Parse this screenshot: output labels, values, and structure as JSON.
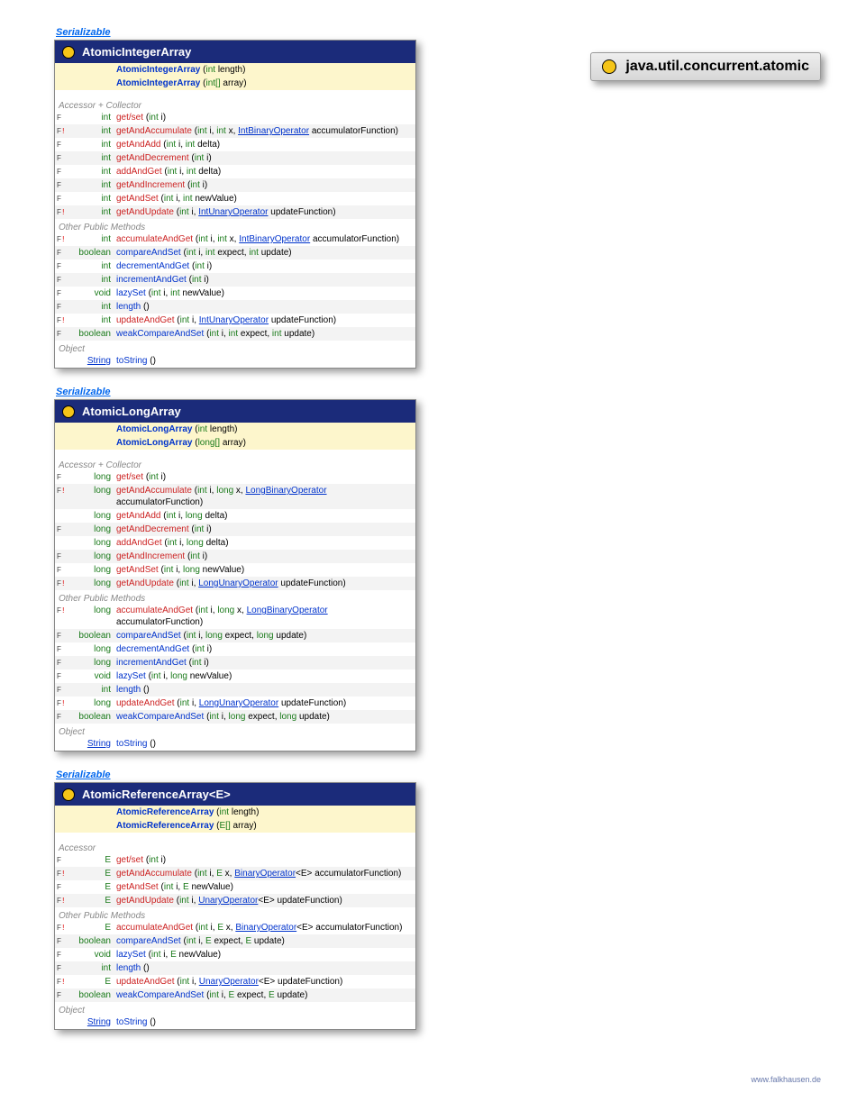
{
  "package": "java.util.concurrent.atomic",
  "serializable_label": "Serializable",
  "footer": "www.falkhausen.de",
  "classes": [
    {
      "name": "AtomicIntegerArray",
      "constructors": [
        {
          "name": "AtomicIntegerArray",
          "params": [
            [
              "int",
              "length"
            ]
          ]
        },
        {
          "name": "AtomicIntegerArray",
          "params": [
            [
              "int[]",
              "array"
            ]
          ]
        }
      ],
      "sections": [
        {
          "title": "Accessor + Collector",
          "methods": [
            {
              "mods": "F",
              "ret": "int",
              "name": "get/set",
              "red": true,
              "params": [
                [
                  "int",
                  "i"
                ]
              ]
            },
            {
              "mods": "F!",
              "ret": "int",
              "name": "getAndAccumulate",
              "red": true,
              "params": [
                [
                  "int",
                  "i"
                ],
                [
                  "int",
                  "x"
                ],
                [
                  "IntBinaryOperator",
                  "accumulatorFunction",
                  "link"
                ]
              ]
            },
            {
              "mods": "F",
              "ret": "int",
              "name": "getAndAdd",
              "red": true,
              "params": [
                [
                  "int",
                  "i"
                ],
                [
                  "int",
                  "delta"
                ]
              ]
            },
            {
              "mods": "F",
              "ret": "int",
              "name": "getAndDecrement",
              "red": true,
              "params": [
                [
                  "int",
                  "i"
                ]
              ]
            },
            {
              "mods": "F",
              "ret": "int",
              "name": "addAndGet",
              "red": true,
              "params": [
                [
                  "int",
                  "i"
                ],
                [
                  "int",
                  "delta"
                ]
              ]
            },
            {
              "mods": "F",
              "ret": "int",
              "name": "getAndIncrement",
              "red": true,
              "params": [
                [
                  "int",
                  "i"
                ]
              ]
            },
            {
              "mods": "F",
              "ret": "int",
              "name": "getAndSet",
              "red": true,
              "params": [
                [
                  "int",
                  "i"
                ],
                [
                  "int",
                  "newValue"
                ]
              ]
            },
            {
              "mods": "F!",
              "ret": "int",
              "name": "getAndUpdate",
              "red": true,
              "params": [
                [
                  "int",
                  "i"
                ],
                [
                  "IntUnaryOperator",
                  "updateFunction",
                  "link"
                ]
              ]
            }
          ]
        },
        {
          "title": "Other Public Methods",
          "methods": [
            {
              "mods": "F!",
              "ret": "int",
              "name": "accumulateAndGet",
              "red": true,
              "params": [
                [
                  "int",
                  "i"
                ],
                [
                  "int",
                  "x"
                ],
                [
                  "IntBinaryOperator",
                  "accumulatorFunction",
                  "link"
                ]
              ]
            },
            {
              "mods": "F",
              "ret": "boolean",
              "name": "compareAndSet",
              "params": [
                [
                  "int",
                  "i"
                ],
                [
                  "int",
                  "expect"
                ],
                [
                  "int",
                  "update"
                ]
              ]
            },
            {
              "mods": "F",
              "ret": "int",
              "name": "decrementAndGet",
              "params": [
                [
                  "int",
                  "i"
                ]
              ]
            },
            {
              "mods": "F",
              "ret": "int",
              "name": "incrementAndGet",
              "params": [
                [
                  "int",
                  "i"
                ]
              ]
            },
            {
              "mods": "F",
              "ret": "void",
              "name": "lazySet",
              "params": [
                [
                  "int",
                  "i"
                ],
                [
                  "int",
                  "newValue"
                ]
              ]
            },
            {
              "mods": "F",
              "ret": "int",
              "name": "length",
              "params": []
            },
            {
              "mods": "F!",
              "ret": "int",
              "name": "updateAndGet",
              "red": true,
              "params": [
                [
                  "int",
                  "i"
                ],
                [
                  "IntUnaryOperator",
                  "updateFunction",
                  "link"
                ]
              ]
            },
            {
              "mods": "F",
              "ret": "boolean",
              "name": "weakCompareAndSet",
              "params": [
                [
                  "int",
                  "i"
                ],
                [
                  "int",
                  "expect"
                ],
                [
                  "int",
                  "update"
                ]
              ]
            }
          ]
        },
        {
          "title": "Object",
          "methods": [
            {
              "mods": "",
              "ret": "String",
              "retlink": true,
              "name": "toString",
              "params": []
            }
          ]
        }
      ]
    },
    {
      "name": "AtomicLongArray",
      "constructors": [
        {
          "name": "AtomicLongArray",
          "params": [
            [
              "int",
              "length"
            ]
          ]
        },
        {
          "name": "AtomicLongArray",
          "params": [
            [
              "long[]",
              "array"
            ]
          ]
        }
      ],
      "sections": [
        {
          "title": "Accessor + Collector",
          "methods": [
            {
              "mods": "F",
              "ret": "long",
              "name": "get/set",
              "red": true,
              "params": [
                [
                  "int",
                  "i"
                ]
              ]
            },
            {
              "mods": "F!",
              "ret": "long",
              "name": "getAndAccumulate",
              "red": true,
              "params": [
                [
                  "int",
                  "i"
                ],
                [
                  "long",
                  "x"
                ],
                [
                  "LongBinaryOperator",
                  "accumulatorFunction",
                  "link"
                ]
              ]
            },
            {
              "mods": "",
              "ret": "long",
              "name": "getAndAdd",
              "red": true,
              "params": [
                [
                  "int",
                  "i"
                ],
                [
                  "long",
                  "delta"
                ]
              ]
            },
            {
              "mods": "F",
              "ret": "long",
              "name": "getAndDecrement",
              "red": true,
              "params": [
                [
                  "int",
                  "i"
                ]
              ]
            },
            {
              "mods": "",
              "ret": "long",
              "name": "addAndGet",
              "red": true,
              "params": [
                [
                  "int",
                  "i"
                ],
                [
                  "long",
                  "delta"
                ]
              ]
            },
            {
              "mods": "F",
              "ret": "long",
              "name": "getAndIncrement",
              "red": true,
              "params": [
                [
                  "int",
                  "i"
                ]
              ]
            },
            {
              "mods": "F",
              "ret": "long",
              "name": "getAndSet",
              "red": true,
              "params": [
                [
                  "int",
                  "i"
                ],
                [
                  "long",
                  "newValue"
                ]
              ]
            },
            {
              "mods": "F!",
              "ret": "long",
              "name": "getAndUpdate",
              "red": true,
              "params": [
                [
                  "int",
                  "i"
                ],
                [
                  "LongUnaryOperator",
                  "updateFunction",
                  "link"
                ]
              ]
            }
          ]
        },
        {
          "title": "Other Public Methods",
          "methods": [
            {
              "mods": "F!",
              "ret": "long",
              "name": "accumulateAndGet",
              "red": true,
              "params": [
                [
                  "int",
                  "i"
                ],
                [
                  "long",
                  "x"
                ],
                [
                  "LongBinaryOperator",
                  "accumulatorFunction",
                  "link"
                ]
              ]
            },
            {
              "mods": "F",
              "ret": "boolean",
              "name": "compareAndSet",
              "params": [
                [
                  "int",
                  "i"
                ],
                [
                  "long",
                  "expect"
                ],
                [
                  "long",
                  "update"
                ]
              ]
            },
            {
              "mods": "F",
              "ret": "long",
              "name": "decrementAndGet",
              "params": [
                [
                  "int",
                  "i"
                ]
              ]
            },
            {
              "mods": "F",
              "ret": "long",
              "name": "incrementAndGet",
              "params": [
                [
                  "int",
                  "i"
                ]
              ]
            },
            {
              "mods": "F",
              "ret": "void",
              "name": "lazySet",
              "params": [
                [
                  "int",
                  "i"
                ],
                [
                  "long",
                  "newValue"
                ]
              ]
            },
            {
              "mods": "F",
              "ret": "int",
              "name": "length",
              "params": []
            },
            {
              "mods": "F!",
              "ret": "long",
              "name": "updateAndGet",
              "red": true,
              "params": [
                [
                  "int",
                  "i"
                ],
                [
                  "LongUnaryOperator",
                  "updateFunction",
                  "link"
                ]
              ]
            },
            {
              "mods": "F",
              "ret": "boolean",
              "name": "weakCompareAndSet",
              "params": [
                [
                  "int",
                  "i"
                ],
                [
                  "long",
                  "expect"
                ],
                [
                  "long",
                  "update"
                ]
              ]
            }
          ]
        },
        {
          "title": "Object",
          "methods": [
            {
              "mods": "",
              "ret": "String",
              "retlink": true,
              "name": "toString",
              "params": []
            }
          ]
        }
      ]
    },
    {
      "name": "AtomicReferenceArray<E>",
      "constructors": [
        {
          "name": "AtomicReferenceArray",
          "params": [
            [
              "int",
              "length"
            ]
          ]
        },
        {
          "name": "AtomicReferenceArray",
          "params": [
            [
              "E[]",
              "array"
            ]
          ]
        }
      ],
      "sections": [
        {
          "title": "Accessor",
          "methods": [
            {
              "mods": "F",
              "ret": "E",
              "name": "get/set",
              "red": true,
              "params": [
                [
                  "int",
                  "i"
                ]
              ]
            },
            {
              "mods": "F!",
              "ret": "E",
              "name": "getAndAccumulate",
              "red": true,
              "params": [
                [
                  "int",
                  "i"
                ],
                [
                  "E",
                  "x"
                ],
                [
                  "BinaryOperator<E>",
                  "accumulatorFunction",
                  "link"
                ]
              ]
            },
            {
              "mods": "F",
              "ret": "E",
              "name": "getAndSet",
              "red": true,
              "params": [
                [
                  "int",
                  "i"
                ],
                [
                  "E",
                  "newValue"
                ]
              ]
            },
            {
              "mods": "F!",
              "ret": "E",
              "name": "getAndUpdate",
              "red": true,
              "params": [
                [
                  "int",
                  "i"
                ],
                [
                  "UnaryOperator<E>",
                  "updateFunction",
                  "link"
                ]
              ]
            }
          ]
        },
        {
          "title": "Other Public Methods",
          "methods": [
            {
              "mods": "F!",
              "ret": "E",
              "name": "accumulateAndGet",
              "red": true,
              "params": [
                [
                  "int",
                  "i"
                ],
                [
                  "E",
                  "x"
                ],
                [
                  "BinaryOperator<E>",
                  "accumulatorFunction",
                  "link"
                ]
              ]
            },
            {
              "mods": "F",
              "ret": "boolean",
              "name": "compareAndSet",
              "params": [
                [
                  "int",
                  "i"
                ],
                [
                  "E",
                  "expect"
                ],
                [
                  "E",
                  "update"
                ]
              ]
            },
            {
              "mods": "F",
              "ret": "void",
              "name": "lazySet",
              "params": [
                [
                  "int",
                  "i"
                ],
                [
                  "E",
                  "newValue"
                ]
              ]
            },
            {
              "mods": "F",
              "ret": "int",
              "name": "length",
              "params": []
            },
            {
              "mods": "F!",
              "ret": "E",
              "name": "updateAndGet",
              "red": true,
              "params": [
                [
                  "int",
                  "i"
                ],
                [
                  "UnaryOperator<E>",
                  "updateFunction",
                  "link"
                ]
              ]
            },
            {
              "mods": "F",
              "ret": "boolean",
              "name": "weakCompareAndSet",
              "params": [
                [
                  "int",
                  "i"
                ],
                [
                  "E",
                  "expect"
                ],
                [
                  "E",
                  "update"
                ]
              ]
            }
          ]
        },
        {
          "title": "Object",
          "methods": [
            {
              "mods": "",
              "ret": "String",
              "retlink": true,
              "name": "toString",
              "params": []
            }
          ]
        }
      ]
    }
  ]
}
